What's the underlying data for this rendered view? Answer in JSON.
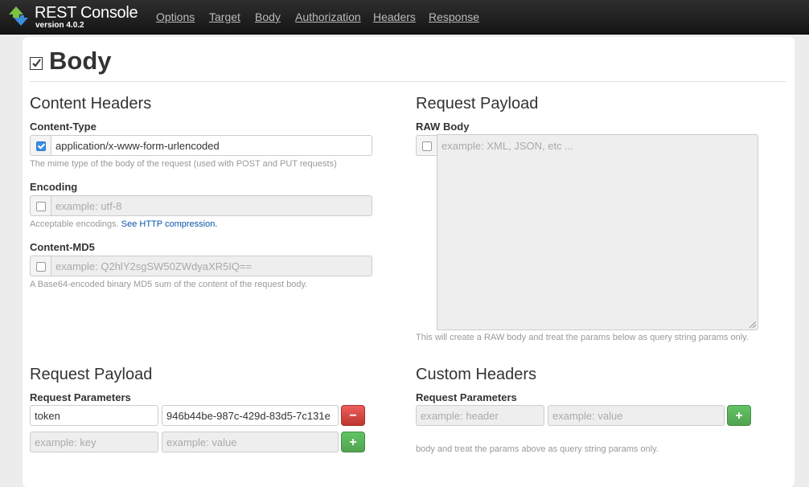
{
  "brand": {
    "title": "REST Console",
    "version": "version 4.0.2",
    "logo_icon": "rest-console-logo-icon"
  },
  "nav": [
    {
      "label": "Options"
    },
    {
      "label": "Target"
    },
    {
      "label": "Body"
    },
    {
      "label": "Authorization"
    },
    {
      "label": "Headers"
    },
    {
      "label": "Response"
    }
  ],
  "section": {
    "title": "Body",
    "collapse_icon": "checkbox-icon"
  },
  "content_headers": {
    "title": "Content Headers",
    "content_type": {
      "label": "Content-Type",
      "enabled": true,
      "value": "application/x-www-form-urlencoded",
      "help": "The mime type of the body of the request (used with POST and PUT requests)"
    },
    "encoding": {
      "label": "Encoding",
      "enabled": false,
      "placeholder": "example: utf-8",
      "help_text": "Acceptable encodings.",
      "help_link": "See HTTP compression."
    },
    "content_md5": {
      "label": "Content-MD5",
      "enabled": false,
      "placeholder": "example: Q2hlY2sgSW50ZWdyaXR5IQ==",
      "help": "A Base64-encoded binary MD5 sum of the content of the request body."
    }
  },
  "raw_payload": {
    "title": "Request Payload",
    "label": "RAW Body",
    "enabled": false,
    "placeholder": "example: XML, JSON, etc ...",
    "help": "This will create a RAW body and treat the params below as query string params only."
  },
  "request_payload": {
    "title": "Request Payload",
    "label": "Request Parameters",
    "row1_key": "token",
    "row1_value": "946b44be-987c-429d-83d5-7c131e",
    "key_placeholder": "example: key",
    "value_placeholder": "example: value",
    "remove_label": "−",
    "add_label": "+"
  },
  "custom_headers": {
    "title": "Custom Headers",
    "label": "Request Parameters",
    "header_placeholder": "example: header",
    "value_placeholder": "example: value",
    "add_label": "+",
    "help": "body and treat the params above as query string params only."
  },
  "colors": {
    "accent": "#3a8ee6",
    "danger": "#da4f49",
    "success": "#5bb75b",
    "navbar": "#1b1b1b",
    "link": "#0b54a6"
  }
}
